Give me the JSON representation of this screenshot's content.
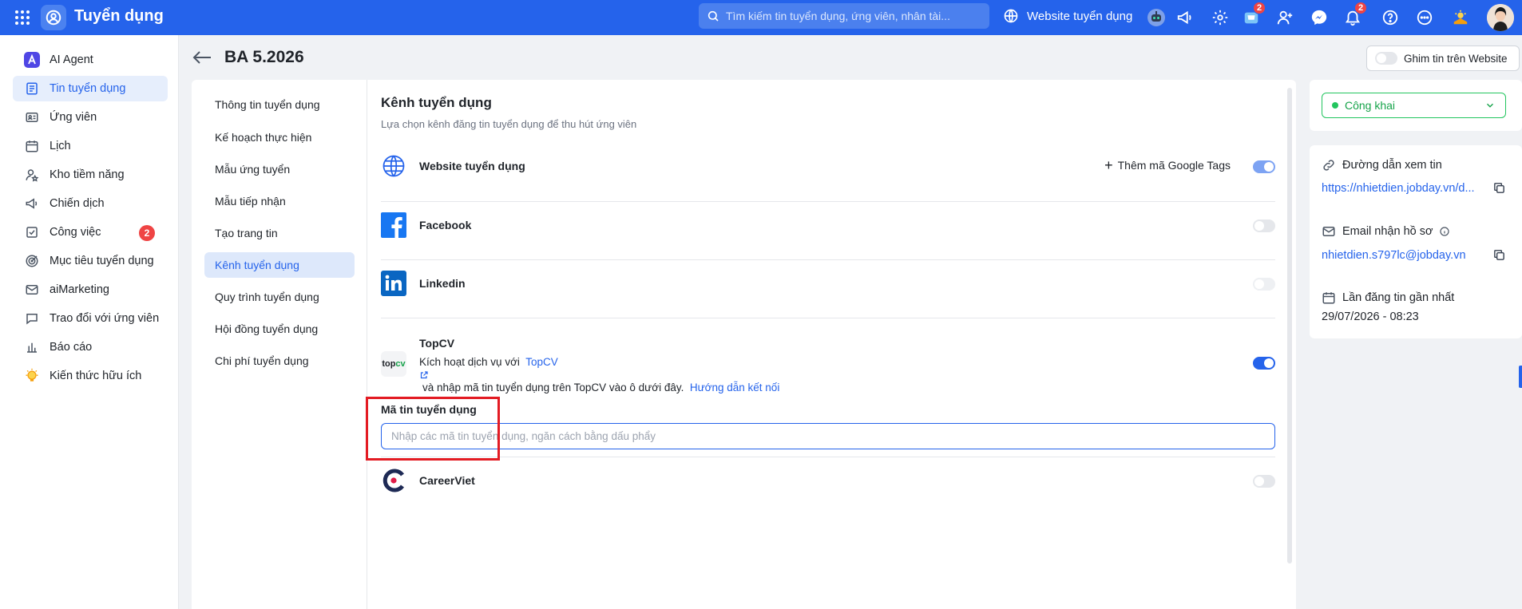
{
  "topbar": {
    "app_title": "Tuyển dụng",
    "search_placeholder": "Tìm kiếm tin tuyển dụng, ứng viên, nhân tài...",
    "website_label": "Website tuyển dụng",
    "cart_badge": "2",
    "notification_badge": "2",
    "accent_color": "#2563eb"
  },
  "sidebar": {
    "items": [
      {
        "label": "AI Agent",
        "icon": "ai-agent-icon"
      },
      {
        "label": "Tin tuyển dụng",
        "icon": "document-icon"
      },
      {
        "label": "Ứng viên",
        "icon": "id-card-icon"
      },
      {
        "label": "Lịch",
        "icon": "calendar-icon"
      },
      {
        "label": "Kho tiềm năng",
        "icon": "user-star-icon"
      },
      {
        "label": "Chiến dịch",
        "icon": "megaphone-icon"
      },
      {
        "label": "Công việc",
        "icon": "checkbox-icon",
        "badge": "2"
      },
      {
        "label": "Mục tiêu tuyển dụng",
        "icon": "target-icon"
      },
      {
        "label": "aiMarketing",
        "icon": "mail-icon"
      },
      {
        "label": "Trao đổi với ứng viên",
        "icon": "chat-icon"
      },
      {
        "label": "Báo cáo",
        "icon": "bar-chart-icon"
      },
      {
        "label": "Kiến thức hữu ích",
        "icon": "lightbulb-icon"
      }
    ]
  },
  "page": {
    "title": "BA 5.2026",
    "pin_label": "Ghim tin trên Website"
  },
  "subnav": {
    "items": [
      "Thông tin tuyển dụng",
      "Kế hoạch thực hiện",
      "Mẫu ứng tuyển",
      "Mẫu tiếp nhận",
      "Tạo trang tin",
      "Kênh tuyển dụng",
      "Quy trình tuyển dụng",
      "Hội đồng tuyển dụng",
      "Chi phí tuyển dụng"
    ]
  },
  "channels": {
    "title": "Kênh tuyển dụng",
    "subtitle": "Lựa chọn kênh đăng tin tuyển dụng để thu hút ứng viên",
    "website": {
      "name": "Website tuyển dụng",
      "google_tags": "Thêm mã Google Tags",
      "enabled": true
    },
    "facebook": {
      "name": "Facebook",
      "enabled": false
    },
    "linkedin": {
      "name": "Linkedin",
      "enabled": false
    },
    "topcv": {
      "name": "TopCV",
      "logo_text_top": "top",
      "logo_text_cv": "cv",
      "desc_prefix": "Kích hoạt dịch vụ với",
      "desc_link": "TopCV",
      "desc_suffix": "và nhập mã tin tuyển dụng trên TopCV vào ô dưới đây.",
      "guide_link": "Hướng dẫn kết nối",
      "enabled": true
    },
    "code_field": {
      "label": "Mã tin tuyển dụng",
      "value": "",
      "placeholder": "Nhập các mã tin tuyển dụng, ngăn cách bằng dấu phẩy"
    },
    "careerviet": {
      "name": "CareerViet",
      "enabled": false
    }
  },
  "right_panel": {
    "status": "Công khai",
    "status_color": "#22c55e",
    "view_link_label": "Đường dẫn xem tin",
    "view_link": "https://nhietdien.jobday.vn/d...",
    "email_label": "Email nhận hồ sơ",
    "email": "nhietdien.s797lc@jobday.vn",
    "last_post_label": "Lần đăng tin gần nhất",
    "last_post_value": "29/07/2026 - 08:23"
  }
}
